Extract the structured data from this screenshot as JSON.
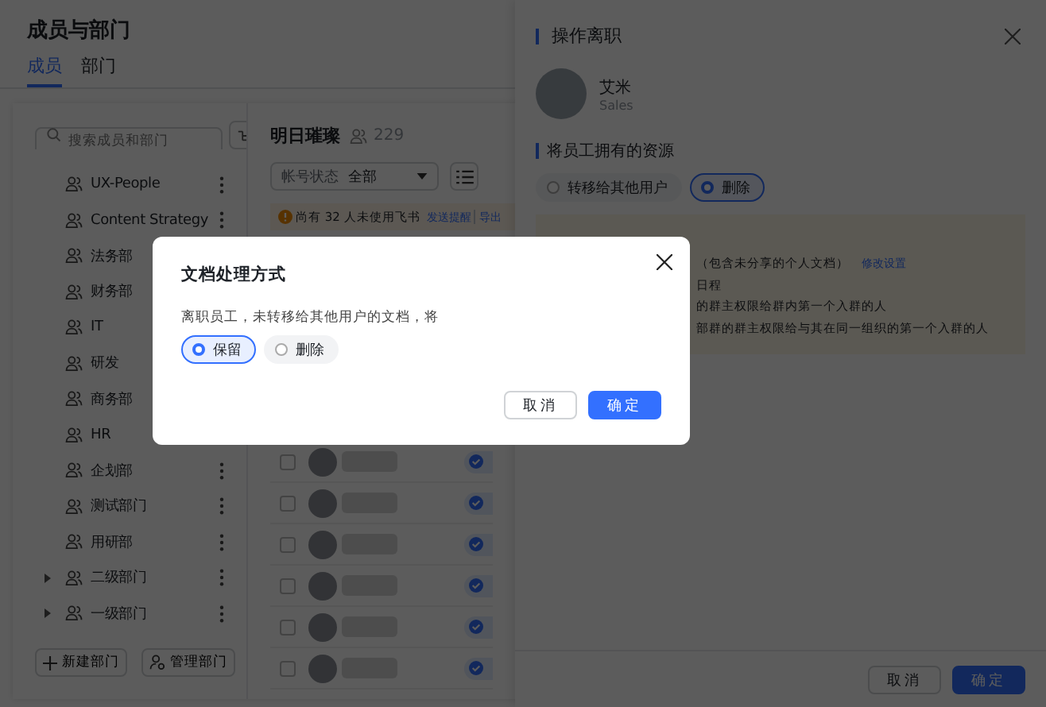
{
  "page": {
    "title": "成员与部门",
    "tabs": [
      {
        "label": "成员",
        "selected": true
      },
      {
        "label": "部门",
        "selected": false
      }
    ]
  },
  "departments": {
    "search_placeholder": "搜索成员和部门",
    "items": [
      {
        "label": "UX-People",
        "expandable": false
      },
      {
        "label": "Content Strategy",
        "expandable": false
      },
      {
        "label": "法务部",
        "expandable": false
      },
      {
        "label": "财务部",
        "expandable": false
      },
      {
        "label": "IT",
        "expandable": false
      },
      {
        "label": "研发",
        "expandable": false
      },
      {
        "label": "商务部",
        "expandable": false
      },
      {
        "label": "HR",
        "expandable": false
      },
      {
        "label": "企划部",
        "expandable": false
      },
      {
        "label": "测试部门",
        "expandable": false
      },
      {
        "label": "用研部",
        "expandable": false
      },
      {
        "label": "二级部门",
        "expandable": true
      },
      {
        "label": "一级部门",
        "expandable": true
      }
    ],
    "buttons": [
      {
        "label": "新建部门",
        "kind": "add"
      },
      {
        "label": "管理部门",
        "kind": "manage"
      }
    ]
  },
  "members": {
    "title": "明日璀璨",
    "count": "229",
    "filter": {
      "label": "帐号状态",
      "value": "全部"
    },
    "notice": {
      "text": "尚有 32 人未使用飞书",
      "links": [
        "发送提醒",
        "导出"
      ]
    },
    "rows": [
      {
        "checked": false
      },
      {
        "checked": false
      },
      {
        "checked": false
      },
      {
        "checked": false
      },
      {
        "checked": false
      },
      {
        "checked": false
      }
    ]
  },
  "drawer": {
    "title": "操作离职",
    "employee": {
      "name": "艾米",
      "department": "Sales"
    },
    "section": "将员工拥有的资源",
    "options": [
      {
        "label": "转移给其他用户",
        "selected": false
      },
      {
        "label": "删除",
        "selected": true
      }
    ],
    "notes": [
      {
        "text": "（包含未分享的个人文档）",
        "link": "修改设置"
      },
      {
        "text": "日程"
      },
      {
        "text": "的群主权限给群内第一个入群的人"
      },
      {
        "text": "部群的群主权限给与其在同一组织的第一个入群的人"
      }
    ],
    "buttons": [
      {
        "label": "取消",
        "kind": "secondary"
      },
      {
        "label": "确定",
        "kind": "primary"
      }
    ]
  },
  "dialog": {
    "title": "文档处理方式",
    "message": "离职员工，未转移给其他用户的文档，将",
    "options": [
      {
        "label": "保留",
        "selected": true
      },
      {
        "label": "删除",
        "selected": false
      }
    ],
    "buttons": [
      {
        "label": "取消",
        "kind": "secondary"
      },
      {
        "label": "确定",
        "kind": "primary"
      }
    ]
  }
}
